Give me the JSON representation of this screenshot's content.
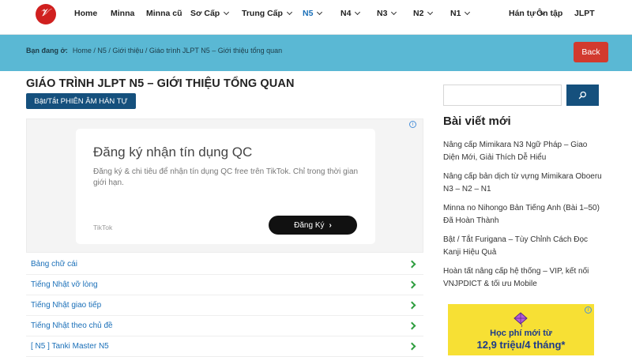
{
  "nav": {
    "items": [
      {
        "label": "Home",
        "dropdown": false,
        "active": false
      },
      {
        "label": "Minna",
        "dropdown": false,
        "active": false
      },
      {
        "label": "Minna cũ",
        "dropdown": false,
        "active": false
      },
      {
        "label": "Sơ Cấp",
        "dropdown": true,
        "active": false
      },
      {
        "label": "Trung Cấp",
        "dropdown": true,
        "active": false
      },
      {
        "label": "N5",
        "dropdown": true,
        "active": true
      },
      {
        "label": "N4",
        "dropdown": true,
        "active": false
      },
      {
        "label": "N3",
        "dropdown": true,
        "active": false
      },
      {
        "label": "N2",
        "dropdown": true,
        "active": false
      },
      {
        "label": "N1",
        "dropdown": true,
        "active": false
      },
      {
        "label": "Hán tự",
        "dropdown": true,
        "active": false
      },
      {
        "label": "Ôn tập",
        "dropdown": false,
        "active": false
      },
      {
        "label": "JLPT",
        "dropdown": false,
        "active": false
      }
    ]
  },
  "breadcrumb": {
    "prefix": "Bạn đang ở:",
    "path": "Home / N5 / Giới thiệu / Giáo trình JLPT N5 – Giới thiệu tổng quan"
  },
  "back_label": "Back",
  "main": {
    "title": "GIÁO TRÌNH JLPT N5 – GIỚI THIỆU TỔNG QUAN",
    "toggle_label": "Bật/Tắt PHIÊN ÂM HÁN TỰ",
    "ad": {
      "info": "i",
      "title": "Đăng ký nhận tín dụng QC",
      "description": "Đăng ký & chi tiêu để nhận tín dụng QC free trên TikTok. Chỉ trong thời gian giới hạn.",
      "brand": "TikTok",
      "cta": "Đăng Ký",
      "cta_arrow": "›"
    },
    "list": [
      {
        "label": "Bảng chữ cái"
      },
      {
        "label": "Tiếng Nhật vỡ lòng"
      },
      {
        "label": "Tiếng Nhật giao tiếp"
      },
      {
        "label": "Tiếng Nhật theo chủ đề"
      },
      {
        "label": "[ N5 ] Tanki Master N5"
      }
    ]
  },
  "sidebar": {
    "search_placeholder": "",
    "recent_heading": "Bài viết mới",
    "posts": [
      {
        "text": "Nâng cấp Mimikara N3 Ngữ Pháp – Giao Diện Mới, Giải Thích Dễ Hiểu"
      },
      {
        "text": "Nâng cấp bản dịch từ vựng Mimikara Oboeru N3 – N2 – N1"
      },
      {
        "text": "Minna no Nihongo Bản Tiếng Anh (Bài 1–50) Đã Hoàn Thành"
      },
      {
        "text": "Bật / Tắt Furigana – Tùy Chỉnh Cách Đọc Kanji Hiệu Quả"
      },
      {
        "text": "Hoàn tất nâng cấp hệ thống – VIP, kết nối VNJPDICT & tối ưu Mobile"
      }
    ],
    "ad": {
      "info": "i",
      "line1": "Học phí mới từ",
      "line2": "12,9 triệu/4 tháng*"
    }
  },
  "colors": {
    "accent_blue": "#15507d",
    "link_blue": "#1a6fb8",
    "band": "#5ab8d4",
    "back_red": "#d23a2e",
    "chevron_green": "#2e9e3f",
    "ad_yellow": "#f7e034"
  }
}
